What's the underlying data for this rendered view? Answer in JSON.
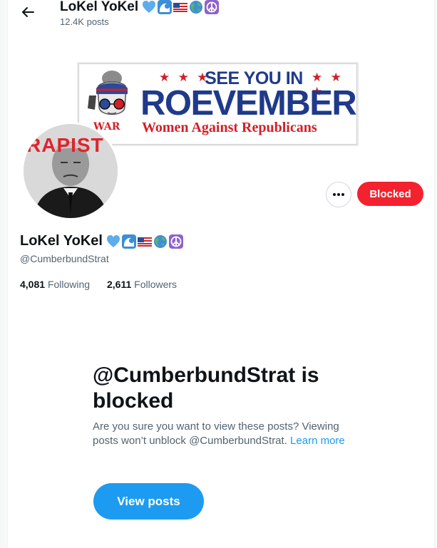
{
  "header": {
    "back_icon": "arrow-left-icon",
    "name": "LoKel YoKel",
    "posts": "12.4K posts"
  },
  "name_emojis": [
    "blue-heart-icon",
    "wave-icon",
    "us-flag-icon",
    "globe-icon",
    "peace-icon"
  ],
  "banner": {
    "stars": "★ ★ ★",
    "line1": "SEE YOU IN",
    "line2": "ROEVEMBER",
    "war": "WAR",
    "line3": "Women Against Republicans"
  },
  "avatar": {
    "overlay_text": "RAPIST"
  },
  "actions": {
    "more_icon": "more-horizontal-icon",
    "blocked_label": "Blocked"
  },
  "profile": {
    "name": "LoKel YoKel",
    "handle": "@CumberbundStrat",
    "following_count": "4,081",
    "following_label": "Following",
    "followers_count": "2,611",
    "followers_label": "Followers"
  },
  "blocked_notice": {
    "title": "@CumberbundStrat is blocked",
    "text": "Are you sure you want to view these posts? Viewing posts won’t unblock @CumberbundStrat.",
    "learn_more": "Learn more",
    "view_button": "View posts"
  },
  "colors": {
    "blocked_red": "#f4212e",
    "link_blue": "#1d9bf0",
    "banner_navy": "#1f3a8a",
    "banner_red": "#d31f26"
  }
}
